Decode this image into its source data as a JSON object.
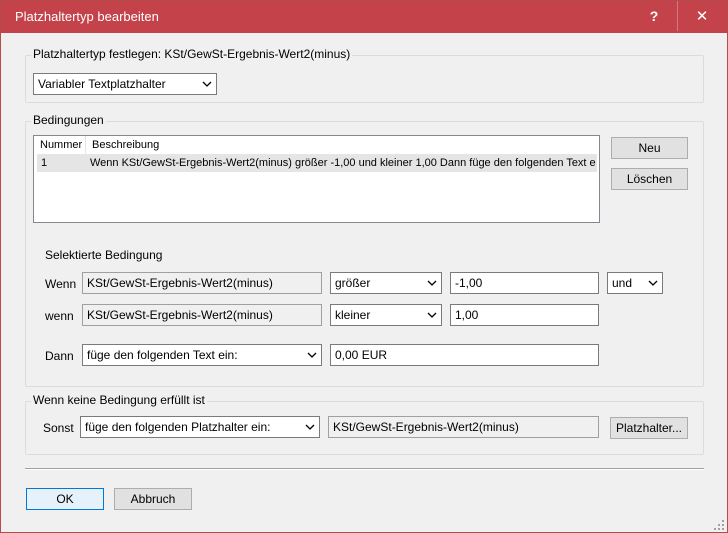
{
  "window": {
    "title": "Platzhaltertyp bearbeiten",
    "help_glyph": "?",
    "close_glyph": "✕",
    "accent": "#c4424a"
  },
  "type_group": {
    "label": "Platzhaltertyp festlegen: KSt/GewSt-Ergebnis-Wert2(minus)",
    "type_select_value": "Variabler Textplatzhalter"
  },
  "conditions_group": {
    "label": "Bedingungen",
    "columns": [
      "Nummer",
      "Beschreibung"
    ],
    "rows": [
      {
        "number": "1",
        "description": "Wenn KSt/GewSt-Ergebnis-Wert2(minus) größer -1,00 und kleiner 1,00 Dann füge den folgenden Text e..."
      }
    ],
    "new_button": "Neu",
    "delete_button": "Löschen"
  },
  "selected_condition": {
    "heading": "Selektierte Bedingung",
    "if_label": "Wenn",
    "if_field": "KSt/GewSt-Ergebnis-Wert2(minus)",
    "if_operator": "größer",
    "if_value": "-1,00",
    "connector": "und",
    "and_label": "wenn",
    "and_field": "KSt/GewSt-Ergebnis-Wert2(minus)",
    "and_operator": "kleiner",
    "and_value": "1,00",
    "then_label": "Dann",
    "then_action": "füge den folgenden Text ein:",
    "then_value": "0,00 EUR"
  },
  "else_group": {
    "label": "Wenn keine Bedingung erfüllt ist",
    "else_label": "Sonst",
    "else_action": "füge den folgenden Platzhalter ein:",
    "else_value": "KSt/GewSt-Ergebnis-Wert2(minus)",
    "placeholder_button": "Platzhalter..."
  },
  "footer": {
    "ok_button": "OK",
    "cancel_button": "Abbruch"
  }
}
